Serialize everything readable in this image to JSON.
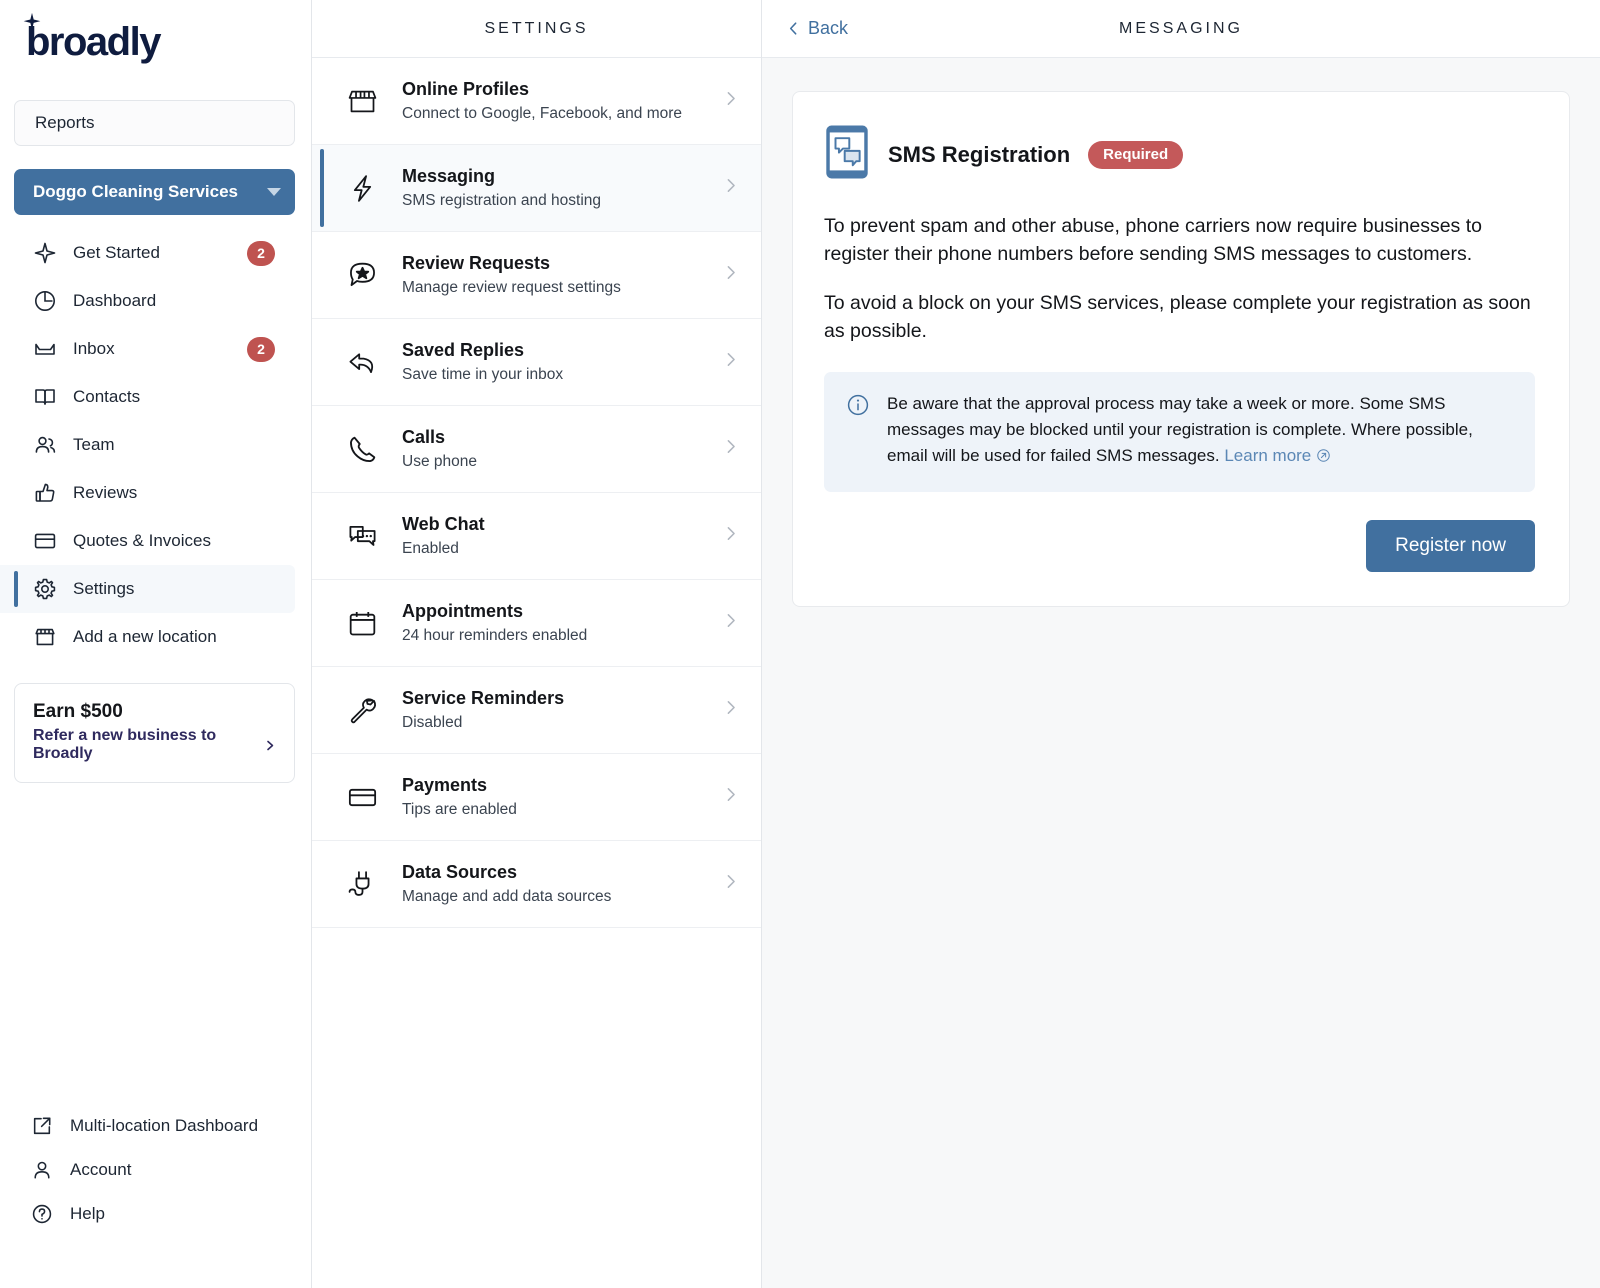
{
  "brand": {
    "logo_text": "broadly",
    "logo_color": "#0f1c3f"
  },
  "sidebar": {
    "reports_label": "Reports",
    "location": {
      "name": "Doggo Cleaning Services",
      "accent_color": "#41709f"
    },
    "items": [
      {
        "label": "Get Started",
        "icon": "sparkle-icon",
        "badge": "2"
      },
      {
        "label": "Dashboard",
        "icon": "pie-chart-icon",
        "badge": ""
      },
      {
        "label": "Inbox",
        "icon": "inbox-icon",
        "badge": "2"
      },
      {
        "label": "Contacts",
        "icon": "book-icon",
        "badge": ""
      },
      {
        "label": "Team",
        "icon": "people-icon",
        "badge": ""
      },
      {
        "label": "Reviews",
        "icon": "thumbs-up-icon",
        "badge": ""
      },
      {
        "label": "Quotes & Invoices",
        "icon": "card-icon",
        "badge": ""
      },
      {
        "label": "Settings",
        "icon": "gear-icon",
        "badge": ""
      },
      {
        "label": "Add a new location",
        "icon": "storefront-icon",
        "badge": ""
      }
    ],
    "active_item": "Settings",
    "promo": {
      "title": "Earn $500",
      "link": "Refer a new business to Broadly",
      "link_color": "#2f2a5e"
    },
    "bottom_items": [
      {
        "label": "Multi-location Dashboard",
        "icon": "external-link-icon"
      },
      {
        "label": "Account",
        "icon": "user-icon"
      },
      {
        "label": "Help",
        "icon": "question-circle-icon"
      }
    ]
  },
  "settings": {
    "header": "SETTINGS",
    "active_item": "Messaging",
    "items": [
      {
        "title": "Online Profiles",
        "subtitle": "Connect to Google, Facebook, and more",
        "icon": "storefront-icon"
      },
      {
        "title": "Messaging",
        "subtitle": "SMS registration and hosting",
        "icon": "lightning-bolt-icon"
      },
      {
        "title": "Review Requests",
        "subtitle": "Manage review request settings",
        "icon": "chat-star-icon"
      },
      {
        "title": "Saved Replies",
        "subtitle": "Save time in your inbox",
        "icon": "reply-arrow-icon"
      },
      {
        "title": "Calls",
        "subtitle": "Use phone",
        "icon": "phone-icon"
      },
      {
        "title": "Web Chat",
        "subtitle": "Enabled",
        "icon": "chat-bubbles-icon"
      },
      {
        "title": "Appointments",
        "subtitle": "24 hour reminders enabled",
        "icon": "calendar-icon"
      },
      {
        "title": "Service Reminders",
        "subtitle": "Disabled",
        "icon": "wrench-icon"
      },
      {
        "title": "Payments",
        "subtitle": "Tips are enabled",
        "icon": "credit-card-icon"
      },
      {
        "title": "Data Sources",
        "subtitle": "Manage and add data sources",
        "icon": "plug-icon"
      }
    ]
  },
  "main": {
    "back_label": "Back",
    "title": "MESSAGING",
    "card": {
      "icon": "phone-sms-icon",
      "title": "SMS Registration",
      "badge": "Required",
      "badge_color": "#c4595a",
      "paragraph1": "To prevent spam and other abuse, phone carriers now require businesses to register their phone numbers before sending SMS messages to customers.",
      "paragraph2": "To avoid a block on your SMS services, please complete your registration as soon as possible.",
      "notice": {
        "icon": "info-circle-icon",
        "text": "Be aware that the approval process may take a week or more. Some SMS messages may be blocked until your registration is complete. Where possible, email will be used for failed SMS messages.",
        "link_text": "Learn more",
        "link_color": "#5b87b5"
      },
      "action_label": "Register now",
      "action_color": "#41709f"
    }
  }
}
